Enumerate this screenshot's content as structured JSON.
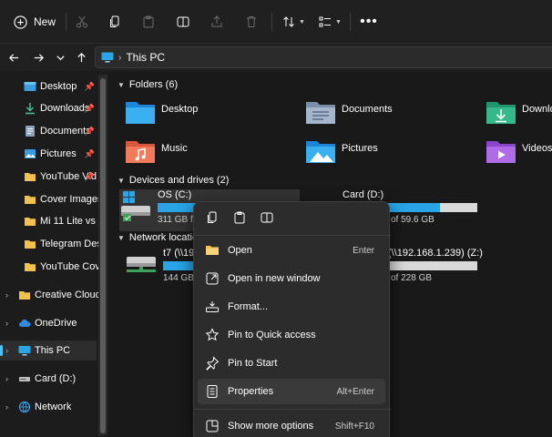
{
  "toolbar": {
    "new_label": "New"
  },
  "address": {
    "location": "This PC"
  },
  "sidebar": {
    "items": [
      {
        "label": "Desktop"
      },
      {
        "label": "Downloads"
      },
      {
        "label": "Documents"
      },
      {
        "label": "Pictures"
      },
      {
        "label": "YouTube Vid"
      },
      {
        "label": "Cover Images"
      },
      {
        "label": "Mi 11 Lite vs iQ"
      },
      {
        "label": "Telegram Deskto"
      },
      {
        "label": "YouTube Cover"
      },
      {
        "label": "Creative Cloud Fi"
      },
      {
        "label": "OneDrive"
      },
      {
        "label": "This PC"
      },
      {
        "label": "Card (D:)"
      },
      {
        "label": "Network"
      }
    ]
  },
  "main": {
    "folders_header": "Folders (6)",
    "folders": [
      {
        "label": "Desktop"
      },
      {
        "label": "Documents"
      },
      {
        "label": "Downlo"
      },
      {
        "label": "Music"
      },
      {
        "label": "Pictures"
      },
      {
        "label": "Videos"
      }
    ],
    "drives_header": "Devices and drives (2)",
    "drives": [
      {
        "name": "OS (C:)",
        "size": "311 GB f",
        "used_fraction": 0.8
      },
      {
        "name": "Card (D:)",
        "size": "of 59.6 GB",
        "used_fraction": 0.78
      }
    ],
    "network_header": "Network locations",
    "network": [
      {
        "name": "t7 (\\\\192",
        "size": "144 GB f",
        "used_fraction": 0.25
      },
      {
        "name": "(\\\\192.168.1.239) (Z:)",
        "size": "of 228 GB",
        "used_fraction": 0.32
      }
    ]
  },
  "context_menu": {
    "items": [
      {
        "label": "Open",
        "shortcut": "Enter"
      },
      {
        "label": "Open in new window",
        "shortcut": ""
      },
      {
        "label": "Format...",
        "shortcut": ""
      },
      {
        "label": "Pin to Quick access",
        "shortcut": ""
      },
      {
        "label": "Pin to Start",
        "shortcut": ""
      },
      {
        "label": "Properties",
        "shortcut": "Alt+Enter"
      },
      {
        "label": "Show more options",
        "shortcut": "Shift+F10"
      }
    ]
  },
  "colors": {
    "accent": "#4cc2ff",
    "drive_fill": "#27a5e6",
    "folder_yellow": "#f2c14e"
  }
}
